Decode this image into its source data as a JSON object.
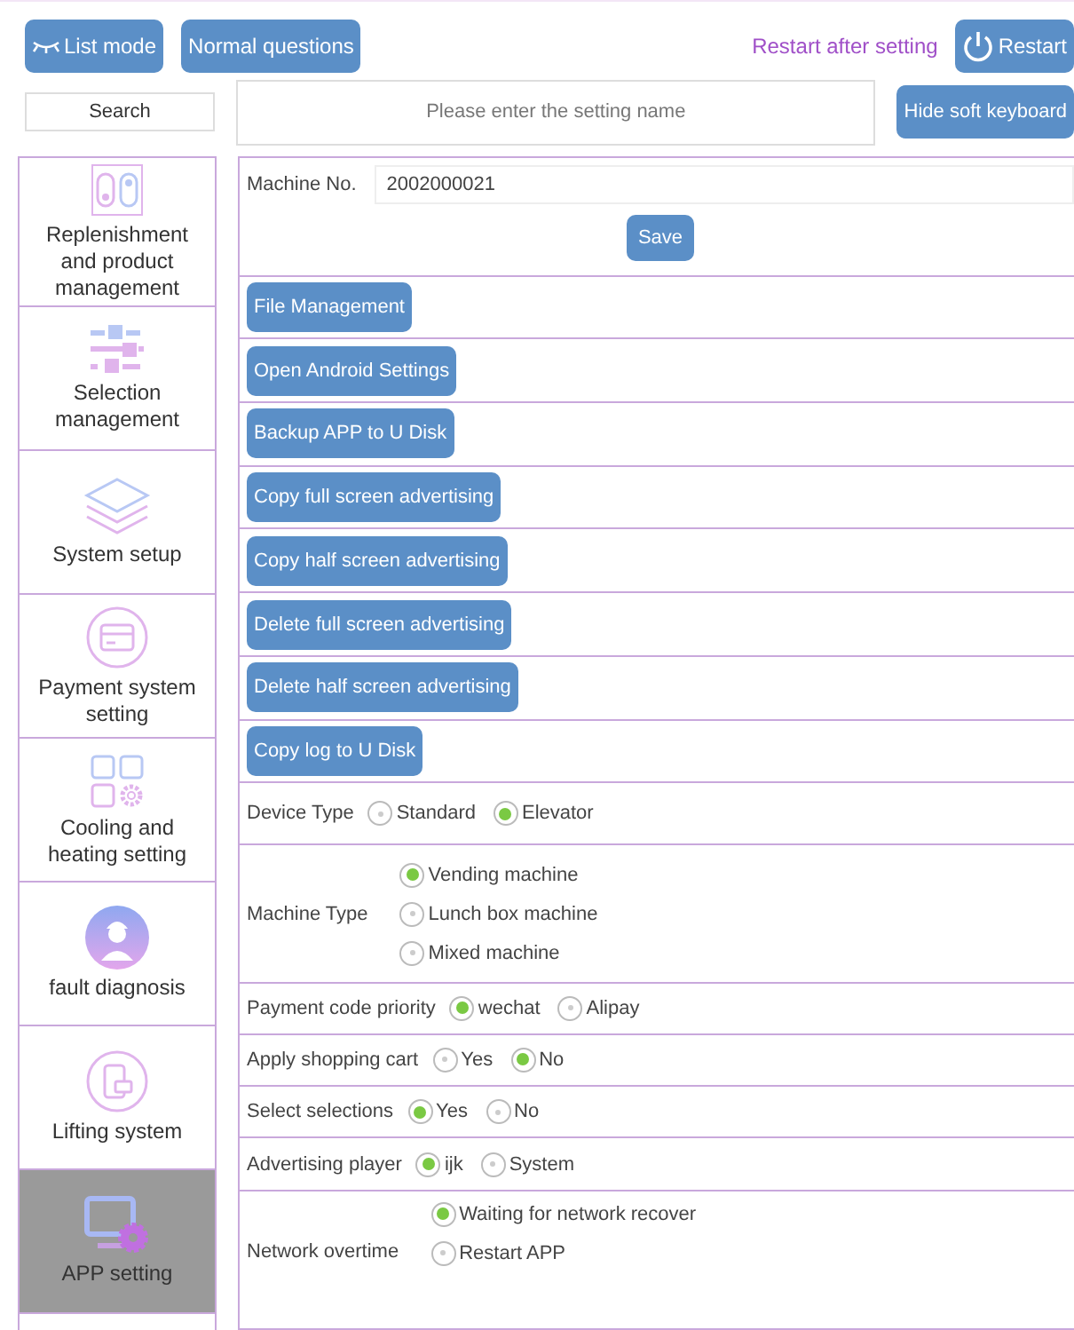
{
  "toolbar": {
    "buttons": [
      {
        "label": "List mode",
        "kind": "list"
      },
      {
        "label": "Normal questions",
        "kind": "plain"
      }
    ],
    "notice": "Restart after setting",
    "restart": "Restart"
  },
  "search_row": {
    "search": "Search",
    "placeholder": "Please enter the setting name",
    "hide_keyboard": "Hide soft keyboard"
  },
  "sidebar": {
    "items": [
      {
        "label": "Replenishment and product management",
        "kind": "replenish",
        "selected": false
      },
      {
        "label": "Selection management",
        "kind": "selection",
        "selected": false
      },
      {
        "label": "System setup",
        "kind": "layers",
        "selected": false
      },
      {
        "label": "Payment system setting",
        "kind": "card",
        "selected": false
      },
      {
        "label": "Cooling and heating setting",
        "kind": "grid",
        "selected": false
      },
      {
        "label": "fault diagnosis",
        "kind": "worker",
        "selected": false
      },
      {
        "label": "Lifting system",
        "kind": "phone",
        "selected": false
      },
      {
        "label": "APP setting",
        "kind": "monitor",
        "selected": true
      }
    ]
  },
  "machine_no": {
    "label": "Machine No.",
    "value": "2002000021",
    "save": "Save"
  },
  "actions": [
    "File Management",
    "Open Android Settings",
    "Backup APP to U Disk",
    "Copy full screen advertising",
    "Copy half screen advertising",
    "Delete full screen advertising",
    "Delete half screen advertising",
    "Copy log to U Disk"
  ],
  "options": [
    {
      "label": "Device Type",
      "kind": "inline",
      "choices": [
        {
          "label": "Standard",
          "selected": false
        },
        {
          "label": "Elevator",
          "selected": true
        }
      ]
    },
    {
      "label": "Machine Type",
      "kind": "stacked",
      "choices": [
        {
          "label": "Vending machine",
          "selected": true
        },
        {
          "label": "Lunch box machine",
          "selected": false
        },
        {
          "label": "Mixed machine",
          "selected": false
        }
      ]
    },
    {
      "label": "Payment code priority",
      "kind": "inline",
      "choices": [
        {
          "label": "wechat",
          "selected": true
        },
        {
          "label": "Alipay",
          "selected": false
        }
      ]
    },
    {
      "label": "Apply shopping cart",
      "kind": "inline",
      "choices": [
        {
          "label": "Yes",
          "selected": false
        },
        {
          "label": "No",
          "selected": true
        }
      ]
    },
    {
      "label": "Select selections",
      "kind": "inline",
      "choices": [
        {
          "label": "Yes",
          "selected": true
        },
        {
          "label": "No",
          "selected": false
        }
      ]
    },
    {
      "label": "Advertising player",
      "kind": "inline",
      "choices": [
        {
          "label": "ijk",
          "selected": true
        },
        {
          "label": "System",
          "selected": false
        }
      ]
    },
    {
      "label": "Network overtime",
      "kind": "stacked",
      "choices": [
        {
          "label": "Waiting for network recover",
          "selected": true
        },
        {
          "label": "Restart APP",
          "selected": false
        }
      ]
    }
  ]
}
